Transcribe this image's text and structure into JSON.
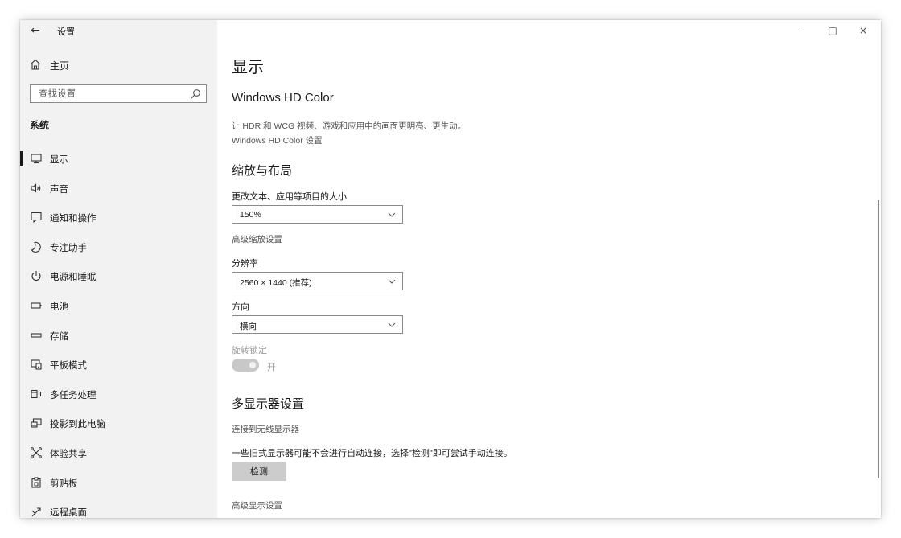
{
  "window": {
    "app_title": "设置",
    "controls": {
      "minimize": "–",
      "maximize": "□",
      "close": "×"
    }
  },
  "sidebar": {
    "home_label": "主页",
    "search_placeholder": "查找设置",
    "section_label": "系统",
    "items": [
      {
        "label": "显示",
        "icon": "monitor-icon",
        "selected": true
      },
      {
        "label": "声音",
        "icon": "speaker-icon",
        "selected": false
      },
      {
        "label": "通知和操作",
        "icon": "notification-icon",
        "selected": false
      },
      {
        "label": "专注助手",
        "icon": "moon-icon",
        "selected": false
      },
      {
        "label": "电源和睡眠",
        "icon": "power-icon",
        "selected": false
      },
      {
        "label": "电池",
        "icon": "battery-icon",
        "selected": false
      },
      {
        "label": "存储",
        "icon": "storage-icon",
        "selected": false
      },
      {
        "label": "平板模式",
        "icon": "tablet-icon",
        "selected": false
      },
      {
        "label": "多任务处理",
        "icon": "multitask-icon",
        "selected": false
      },
      {
        "label": "投影到此电脑",
        "icon": "project-icon",
        "selected": false
      },
      {
        "label": "体验共享",
        "icon": "share-icon",
        "selected": false
      },
      {
        "label": "剪贴板",
        "icon": "clipboard-icon",
        "selected": false
      },
      {
        "label": "远程桌面",
        "icon": "remote-icon",
        "selected": false
      }
    ]
  },
  "main": {
    "page_title": "显示",
    "hdr": {
      "heading": "Windows HD Color",
      "description": "让 HDR 和 WCG 视频、游戏和应用中的画面更明亮、更生动。",
      "link": "Windows HD Color 设置"
    },
    "scale": {
      "heading": "缩放与布局",
      "size_label": "更改文本、应用等项目的大小",
      "size_value": "150%",
      "advanced_link": "高级缩放设置",
      "resolution_label": "分辨率",
      "resolution_value": "2560 × 1440 (推荐)",
      "orientation_label": "方向",
      "orientation_value": "横向",
      "rotation_lock_label": "旋转锁定",
      "rotation_lock_state": "开"
    },
    "multi": {
      "heading": "多显示器设置",
      "wireless_link": "连接到无线显示器",
      "note": "一些旧式显示器可能不会进行自动连接，选择\"检测\"即可尝试手动连接。",
      "detect_button": "检测",
      "advanced_link": "高级显示设置"
    }
  },
  "colors": {
    "sidebar_bg": "#f2f2f2",
    "button_bg": "#cccccc",
    "toggle_disabled": "#c8c8c8"
  }
}
